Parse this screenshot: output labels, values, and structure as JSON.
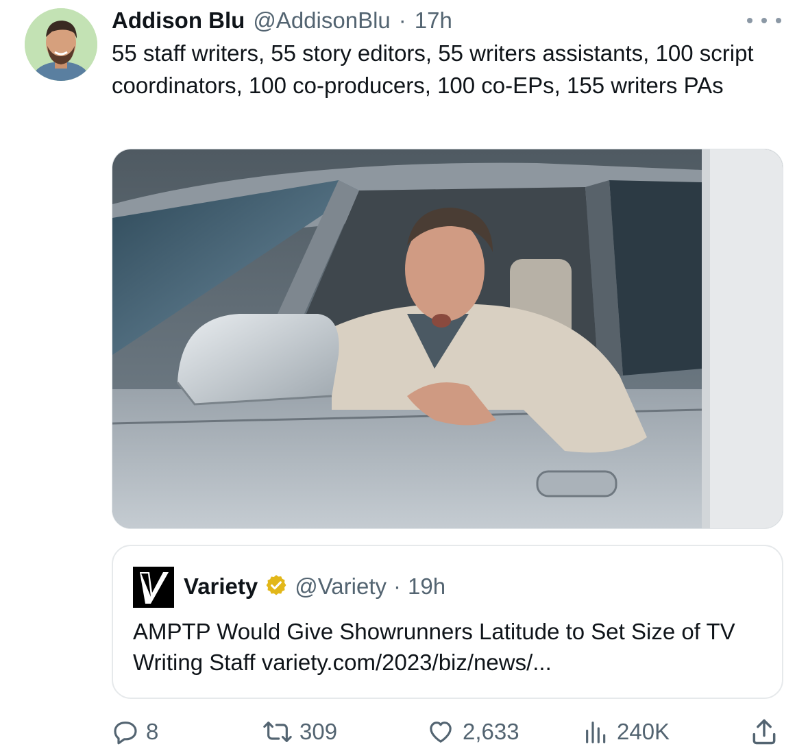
{
  "tweet": {
    "author_name": "Addison Blu",
    "handle": "@AddisonBlu",
    "separator": "·",
    "time": "17h",
    "text": "55 staff writers, 55 story editors, 55 writers assistants, 100 script coordinators, 100 co-producers, 100 co-EPs, 155 writers PAs"
  },
  "quoted_tweet": {
    "author_name": "Variety",
    "handle": "@Variety",
    "separator": "·",
    "time": "19h",
    "verified": true,
    "text": "AMPTP Would Give Showrunners Latitude to Set Size of TV Writing Staff variety.com/2023/biz/news/..."
  },
  "actions": {
    "replies": "8",
    "retweets": "309",
    "likes": "2,633",
    "views": "240K"
  },
  "icons": {
    "more": "more-horizontal-icon",
    "reply": "reply-icon",
    "retweet": "retweet-icon",
    "like": "heart-icon",
    "views": "views-icon",
    "share": "share-icon",
    "verified": "verified-badge-icon"
  },
  "colors": {
    "text_primary": "#0f1419",
    "text_secondary": "#536471",
    "verified_gold": "#e2b719"
  }
}
